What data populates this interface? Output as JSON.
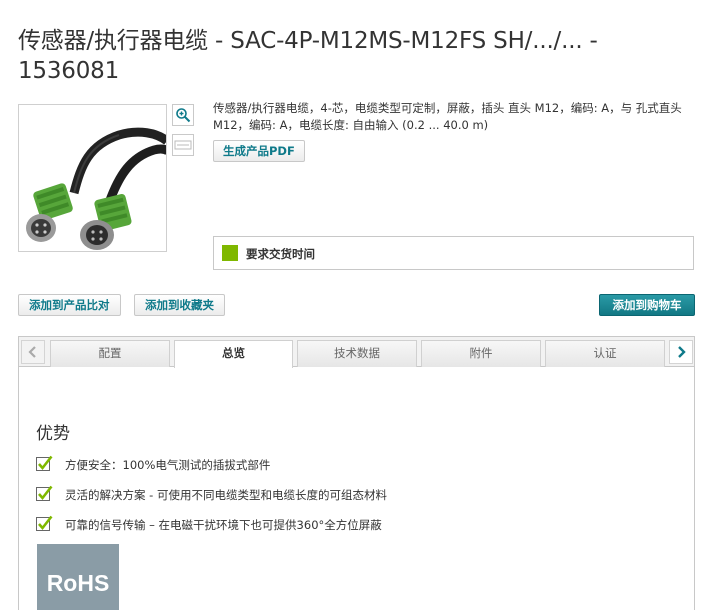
{
  "product": {
    "title": "传感器/执行器电缆 - SAC-4P-M12MS-M12FS SH/.../... - 1536081",
    "description": "传感器/执行器电缆，4-芯，电缆类型可定制，屏蔽，插头 直头 M12，编码: A，与 孔式直头 M12，编码: A，电缆长度: 自由输入 (0.2 ... 40.0 m)",
    "pdf_button": "生成产品PDF",
    "delivery_label": "要求交货时间",
    "delivery_color": "#7fb800"
  },
  "actions": {
    "compare": "添加到产品比对",
    "favorites": "添加到收藏夹",
    "cart": "添加到购物车"
  },
  "tabs": [
    {
      "label": "配置",
      "active": false
    },
    {
      "label": "总览",
      "active": true
    },
    {
      "label": "技术数据",
      "active": false
    },
    {
      "label": "附件",
      "active": false
    },
    {
      "label": "认证",
      "active": false
    }
  ],
  "overview": {
    "heading": "优势",
    "advantages": [
      "方便安全：100%电气测试的插拔式部件",
      "灵活的解决方案 - 可使用不同电缆类型和电缆长度的可组态材料",
      "可靠的信号传输 – 在电磁干扰环境下也可提供360°全方位屏蔽"
    ],
    "badge": "RoHS"
  },
  "icons": {
    "zoom": "zoom-in-icon",
    "thumbnail": "image-thumbnail-icon",
    "tab_prev": "chevron-left-icon",
    "tab_next": "chevron-right-icon",
    "check": "check-mark-icon"
  },
  "colors": {
    "accent": "#0f7a8a",
    "cart_button": "#127884",
    "check_green": "#7fb800",
    "rohs_badge": "#8a9ca6"
  }
}
